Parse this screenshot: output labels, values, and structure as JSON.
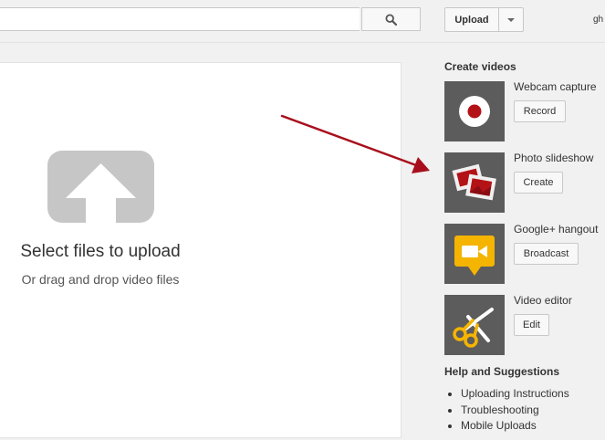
{
  "header": {
    "search_placeholder": "",
    "upload_label": "Upload",
    "user_name": "gh"
  },
  "main": {
    "title": "Select files to upload",
    "subtitle": "Or drag and drop video files"
  },
  "sidebar": {
    "create_title": "Create videos",
    "options": [
      {
        "label": "Webcam capture",
        "button": "Record",
        "icon": "record-icon"
      },
      {
        "label": "Photo slideshow",
        "button": "Create",
        "icon": "photos-icon"
      },
      {
        "label": "Google+ hangout",
        "button": "Broadcast",
        "icon": "video-camera-icon"
      },
      {
        "label": "Video editor",
        "button": "Edit",
        "icon": "scissors-icon"
      }
    ],
    "help_title": "Help and Suggestions",
    "help_links": [
      "Uploading Instructions",
      "Troubleshooting",
      "Mobile Uploads"
    ]
  },
  "colors": {
    "accent_red": "#b31217",
    "annotation_arrow": "#a80f1c",
    "hangout_yellow": "#f5b400",
    "icon_grey": "#c6c6c6"
  }
}
